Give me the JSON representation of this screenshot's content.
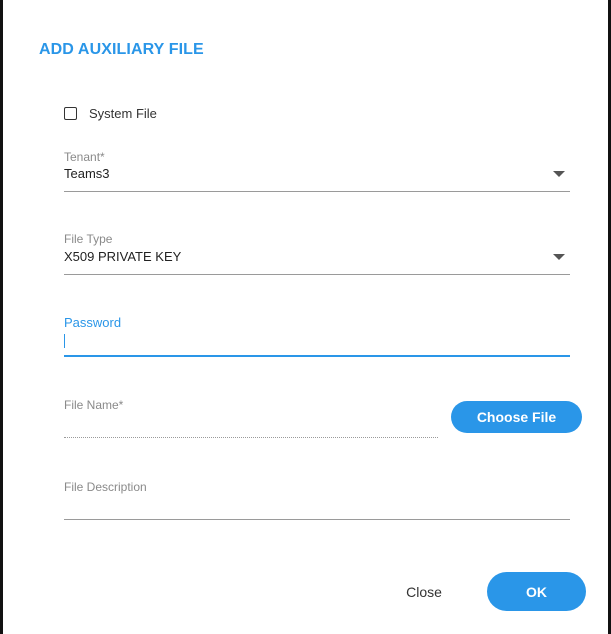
{
  "dialog": {
    "title": "ADD AUXILIARY FILE",
    "accent_color": "#2a96e8"
  },
  "system_file": {
    "label": "System File",
    "checked": false
  },
  "tenant": {
    "label": "Tenant*",
    "value": "Teams3",
    "icon": "chevron-down-icon"
  },
  "file_type": {
    "label": "File Type",
    "value": "X509 PRIVATE KEY",
    "icon": "chevron-down-icon"
  },
  "password": {
    "label": "Password",
    "value": "",
    "focused": true
  },
  "file_name": {
    "label": "File Name*",
    "value": "",
    "choose_button_label": "Choose File"
  },
  "file_description": {
    "label": "File Description",
    "value": ""
  },
  "actions": {
    "close_label": "Close",
    "ok_label": "OK"
  }
}
